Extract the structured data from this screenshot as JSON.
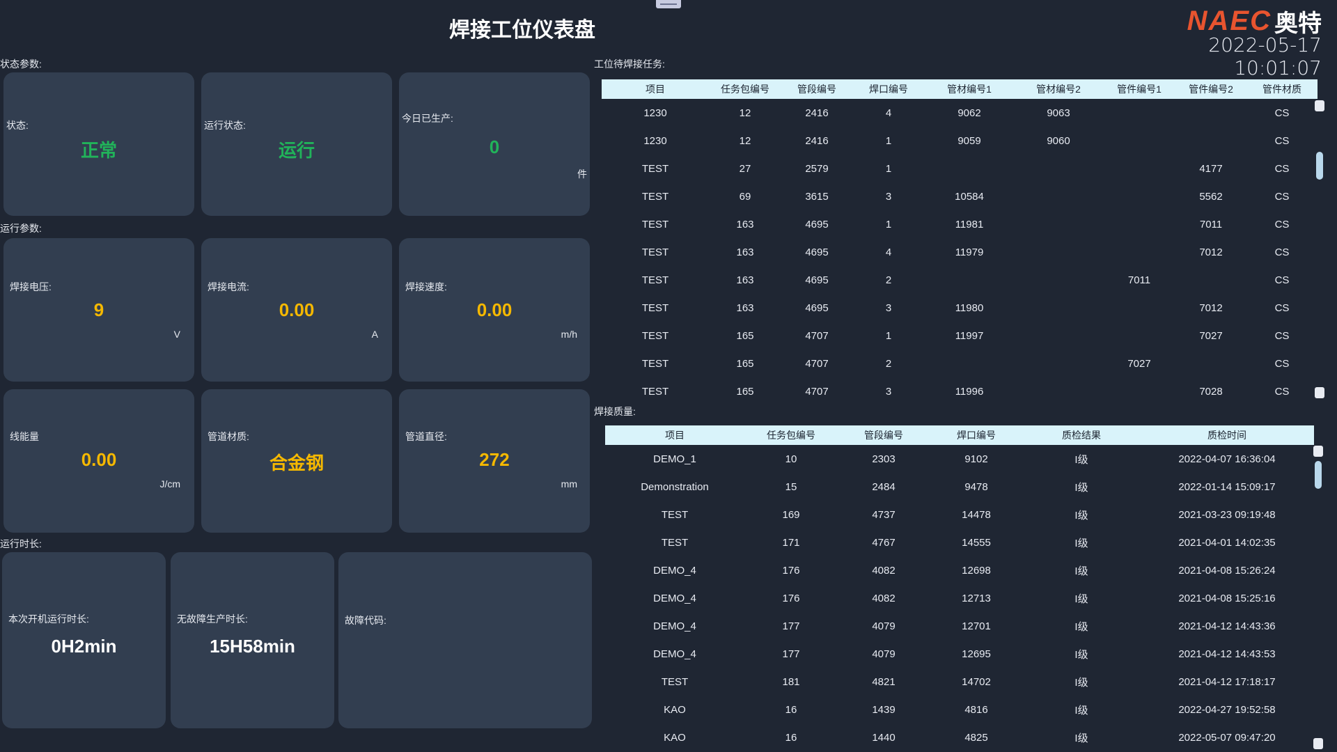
{
  "header": {
    "title": "焊接工位仪表盘",
    "logo_brand": "NAEC",
    "logo_cn": "奥特",
    "datetime": "2022-05-17 10:01:07"
  },
  "status_section": {
    "label": "状态参数:",
    "cards": [
      {
        "label": "状态:",
        "value": "正常",
        "unit": ""
      },
      {
        "label": "运行状态:",
        "value": "运行",
        "unit": ""
      },
      {
        "label": "今日已生产:",
        "value": "0",
        "unit": "件"
      }
    ]
  },
  "run_section": {
    "label": "运行参数:",
    "cards": [
      {
        "label": "焊接电压:",
        "value": "9",
        "unit": "V"
      },
      {
        "label": "焊接电流:",
        "value": "0.00",
        "unit": "A"
      },
      {
        "label": "焊接速度:",
        "value": "0.00",
        "unit": "m/h"
      },
      {
        "label": "线能量",
        "value": "0.00",
        "unit": "J/cm"
      },
      {
        "label": "管道材质:",
        "value": "合金钢",
        "unit": ""
      },
      {
        "label": "管道直径:",
        "value": "272",
        "unit": "mm"
      }
    ]
  },
  "time_section": {
    "label": "运行时长:",
    "cards": [
      {
        "label": "本次开机运行时长:",
        "value": "0H2min"
      },
      {
        "label": "无故障生产时长:",
        "value": "15H58min"
      },
      {
        "label": "故障代码:",
        "value": ""
      }
    ]
  },
  "tasks": {
    "label": "工位待焊接任务:",
    "columns": [
      "项目",
      "任务包编号",
      "管段编号",
      "焊口编号",
      "管材编号1",
      "管材编号2",
      "管件编号1",
      "管件编号2",
      "管件材质"
    ],
    "rows": [
      [
        "1230",
        "12",
        "2416",
        "4",
        "9062",
        "9063",
        "",
        "",
        "CS"
      ],
      [
        "1230",
        "12",
        "2416",
        "1",
        "9059",
        "9060",
        "",
        "",
        "CS"
      ],
      [
        "TEST",
        "27",
        "2579",
        "1",
        "",
        "",
        "",
        "4177",
        "CS"
      ],
      [
        "TEST",
        "69",
        "3615",
        "3",
        "10584",
        "",
        "",
        "5562",
        "CS"
      ],
      [
        "TEST",
        "163",
        "4695",
        "1",
        "11981",
        "",
        "",
        "7011",
        "CS"
      ],
      [
        "TEST",
        "163",
        "4695",
        "4",
        "11979",
        "",
        "",
        "7012",
        "CS"
      ],
      [
        "TEST",
        "163",
        "4695",
        "2",
        "",
        "",
        "7011",
        "",
        "CS"
      ],
      [
        "TEST",
        "163",
        "4695",
        "3",
        "11980",
        "",
        "",
        "7012",
        "CS"
      ],
      [
        "TEST",
        "165",
        "4707",
        "1",
        "11997",
        "",
        "",
        "7027",
        "CS"
      ],
      [
        "TEST",
        "165",
        "4707",
        "2",
        "",
        "",
        "7027",
        "",
        "CS"
      ],
      [
        "TEST",
        "165",
        "4707",
        "3",
        "11996",
        "",
        "",
        "7028",
        "CS"
      ]
    ]
  },
  "quality": {
    "label": "焊接质量:",
    "columns": [
      "项目",
      "任务包编号",
      "管段编号",
      "焊口编号",
      "质检结果",
      "质检时间"
    ],
    "rows": [
      [
        "DEMO_1",
        "10",
        "2303",
        "9102",
        "I级",
        "2022-04-07 16:36:04"
      ],
      [
        "Demonstration",
        "15",
        "2484",
        "9478",
        "I级",
        "2022-01-14 15:09:17"
      ],
      [
        "TEST",
        "169",
        "4737",
        "14478",
        "I级",
        "2021-03-23 09:19:48"
      ],
      [
        "TEST",
        "171",
        "4767",
        "14555",
        "I级",
        "2021-04-01 14:02:35"
      ],
      [
        "DEMO_4",
        "176",
        "4082",
        "12698",
        "I级",
        "2021-04-08 15:26:24"
      ],
      [
        "DEMO_4",
        "176",
        "4082",
        "12713",
        "I级",
        "2021-04-08 15:25:16"
      ],
      [
        "DEMO_4",
        "177",
        "4079",
        "12701",
        "I级",
        "2021-04-12 14:43:36"
      ],
      [
        "DEMO_4",
        "177",
        "4079",
        "12695",
        "I级",
        "2021-04-12 14:43:53"
      ],
      [
        "TEST",
        "181",
        "4821",
        "14702",
        "I级",
        "2021-04-12 17:18:17"
      ],
      [
        "KAO",
        "16",
        "1439",
        "4816",
        "I级",
        "2022-04-27 19:52:58"
      ],
      [
        "KAO",
        "16",
        "1440",
        "4825",
        "I级",
        "2022-05-07 09:47:20"
      ]
    ]
  },
  "colors": {
    "background": "#1f2633",
    "card": "#323e50",
    "ok_green": "#21b35a",
    "value_yellow": "#f5b800",
    "table_header": "#d9f3fa",
    "brand_orange": "#e8542f"
  }
}
